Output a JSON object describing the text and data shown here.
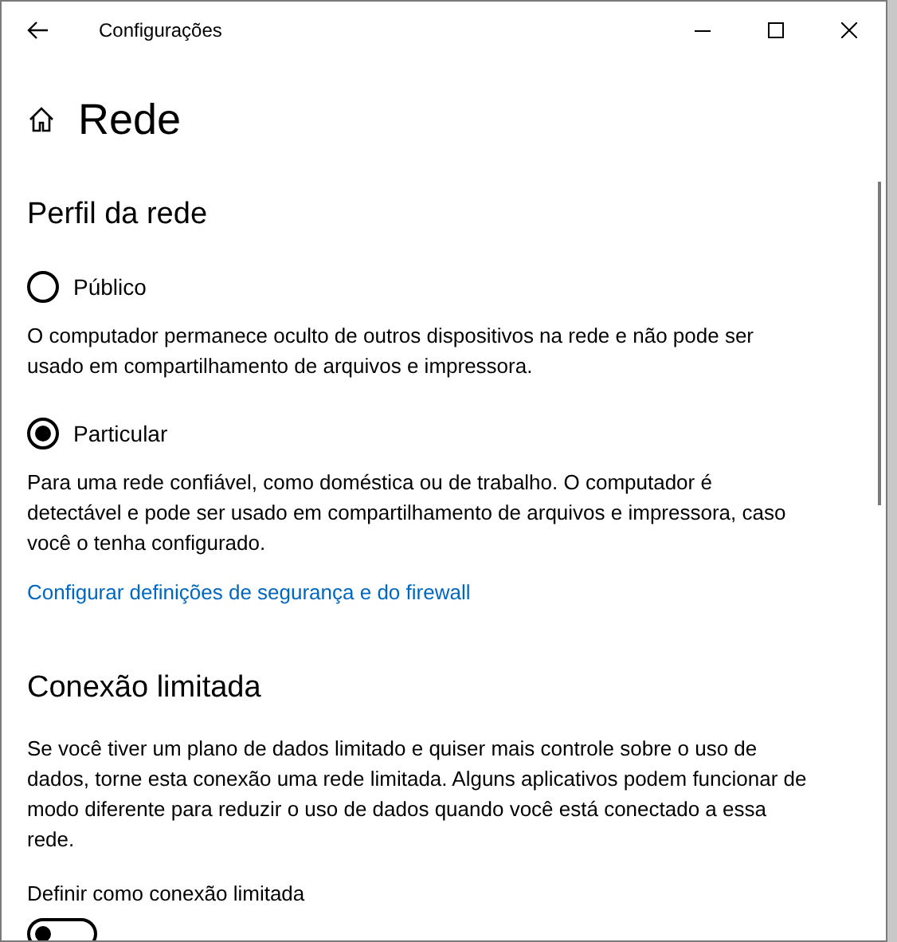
{
  "window": {
    "title": "Configurações"
  },
  "page": {
    "title": "Rede"
  },
  "network_profile": {
    "heading": "Perfil da rede",
    "options": [
      {
        "label": "Público",
        "selected": false,
        "description": "O computador permanece oculto de outros dispositivos na rede e não pode ser usado em compartilhamento de arquivos e impressora."
      },
      {
        "label": "Particular",
        "selected": true,
        "description": "Para uma rede confiável, como doméstica ou de trabalho. O computador é detectável e pode ser usado em compartilhamento de arquivos e impressora, caso você o tenha configurado."
      }
    ],
    "link": "Configurar definições de segurança e do firewall"
  },
  "metered": {
    "heading": "Conexão limitada",
    "description": "Se você tiver um plano de dados limitado e quiser mais controle sobre o uso de dados, torne esta conexão uma rede limitada. Alguns aplicativos podem funcionar de modo diferente para reduzir o uso de dados quando você está conectado a essa rede.",
    "toggle_label": "Definir como conexão limitada",
    "on": false
  }
}
